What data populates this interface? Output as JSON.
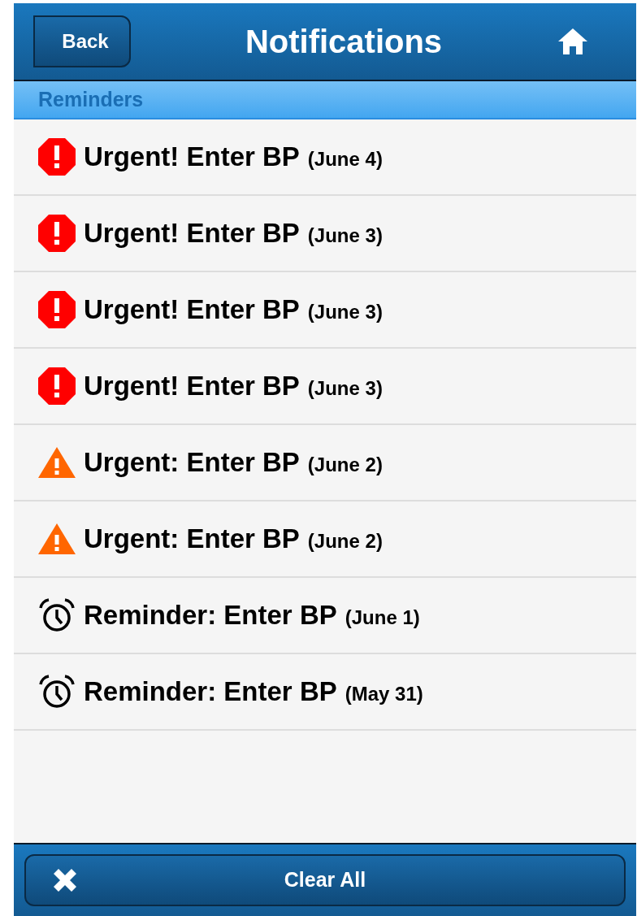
{
  "header": {
    "back": "Back",
    "title": "Notifications"
  },
  "section": "Reminders",
  "notifications": [
    {
      "kind": "critical",
      "title": "Urgent! Enter BP",
      "date": "(June 4)"
    },
    {
      "kind": "critical",
      "title": "Urgent! Enter BP",
      "date": "(June 3)"
    },
    {
      "kind": "critical",
      "title": "Urgent! Enter BP",
      "date": "(June 3)"
    },
    {
      "kind": "critical",
      "title": "Urgent! Enter BP",
      "date": "(June 3)"
    },
    {
      "kind": "warning",
      "title": "Urgent: Enter BP",
      "date": "(June 2)"
    },
    {
      "kind": "warning",
      "title": "Urgent: Enter BP",
      "date": "(June 2)"
    },
    {
      "kind": "reminder",
      "title": "Reminder: Enter BP",
      "date": "(June 1)"
    },
    {
      "kind": "reminder",
      "title": "Reminder: Enter BP",
      "date": "(May 31)"
    }
  ],
  "footer": {
    "button": "Clear All"
  }
}
